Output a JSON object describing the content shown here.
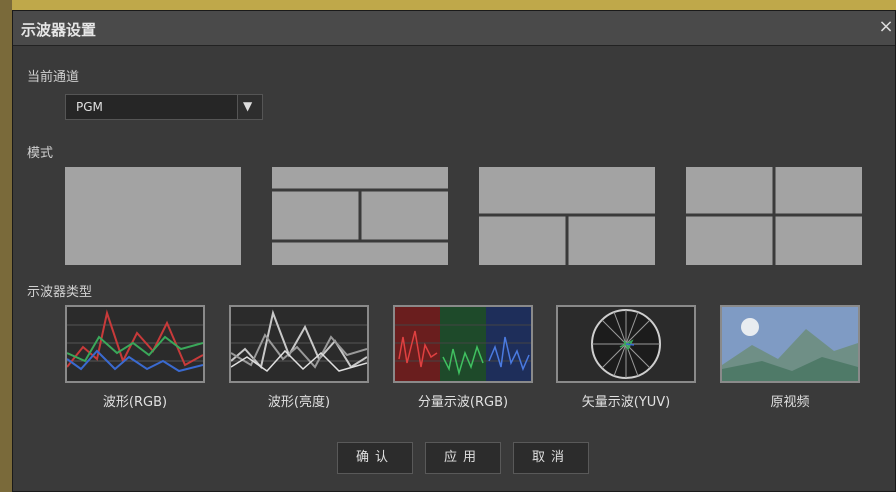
{
  "dialog": {
    "title": "示波器设置",
    "close_icon": "×"
  },
  "channel": {
    "label": "当前通道",
    "selected": "PGM",
    "dropdown_icon": "▼"
  },
  "mode": {
    "label": "模式",
    "options": [
      {
        "name": "single"
      },
      {
        "name": "two-top-bottom-split"
      },
      {
        "name": "one-top-two-bottom"
      },
      {
        "name": "quad"
      }
    ]
  },
  "scope_types": {
    "label": "示波器类型",
    "items": [
      {
        "label": "波形(RGB)",
        "icon": "rgb-waveform-icon"
      },
      {
        "label": "波形(亮度)",
        "icon": "luma-waveform-icon"
      },
      {
        "label": "分量示波(RGB)",
        "icon": "rgb-parade-icon"
      },
      {
        "label": "矢量示波(YUV)",
        "icon": "vectorscope-icon"
      },
      {
        "label": "原视频",
        "icon": "original-video-icon"
      }
    ]
  },
  "buttons": {
    "ok": "确认",
    "apply": "应用",
    "cancel": "取消"
  },
  "colors": {
    "dialog_bg": "#3a3a3a",
    "tile": "#a3a3a3",
    "red": "#d23a3a",
    "green": "#3aa85a",
    "blue": "#3a6ad0"
  }
}
